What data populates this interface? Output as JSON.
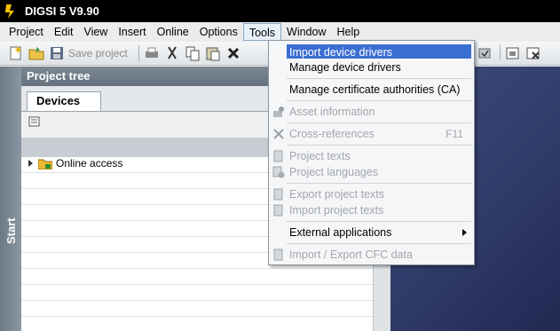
{
  "app": {
    "title": "DIGSI 5 V9.90",
    "logo_icon": "digsi-logo-icon"
  },
  "menubar": {
    "items": [
      {
        "label": "Project"
      },
      {
        "label": "Edit"
      },
      {
        "label": "View"
      },
      {
        "label": "Insert"
      },
      {
        "label": "Online"
      },
      {
        "label": "Options"
      },
      {
        "label": "Tools"
      },
      {
        "label": "Window"
      },
      {
        "label": "Help"
      }
    ],
    "active": "Tools"
  },
  "toolbar": {
    "save_label": "Save project"
  },
  "start_bar": {
    "label": "Start"
  },
  "project_tree": {
    "title": "Project tree",
    "tab_label": "Devices",
    "items": [
      {
        "label": "Online access",
        "icon": "online-folder-icon"
      }
    ]
  },
  "tools_menu": {
    "items": [
      {
        "label": "Import device drivers",
        "highlighted": true,
        "enabled": true
      },
      {
        "label": "Manage device drivers",
        "enabled": true
      },
      {
        "label": "Manage certificate authorities (CA)",
        "enabled": true
      },
      {
        "label": "Asset information",
        "enabled": false,
        "icon": "asset-info-icon"
      },
      {
        "label": "Cross-references",
        "shortcut": "F11",
        "enabled": false,
        "icon": "cross-references-icon"
      },
      {
        "label": "Project texts",
        "enabled": false,
        "icon": "project-texts-icon"
      },
      {
        "label": "Project languages",
        "enabled": false,
        "icon": "project-languages-icon"
      },
      {
        "label": "Export project texts",
        "enabled": false,
        "icon": "export-texts-icon"
      },
      {
        "label": "Import project texts",
        "enabled": false,
        "icon": "import-texts-icon"
      },
      {
        "label": "External applications",
        "enabled": true,
        "submenu": true
      },
      {
        "label": "Import / Export CFC data",
        "enabled": false,
        "icon": "cfc-data-icon"
      }
    ]
  },
  "colors": {
    "highlight": "#3a6ed1",
    "titlebar": "#000000",
    "header": "#6f7c88"
  }
}
